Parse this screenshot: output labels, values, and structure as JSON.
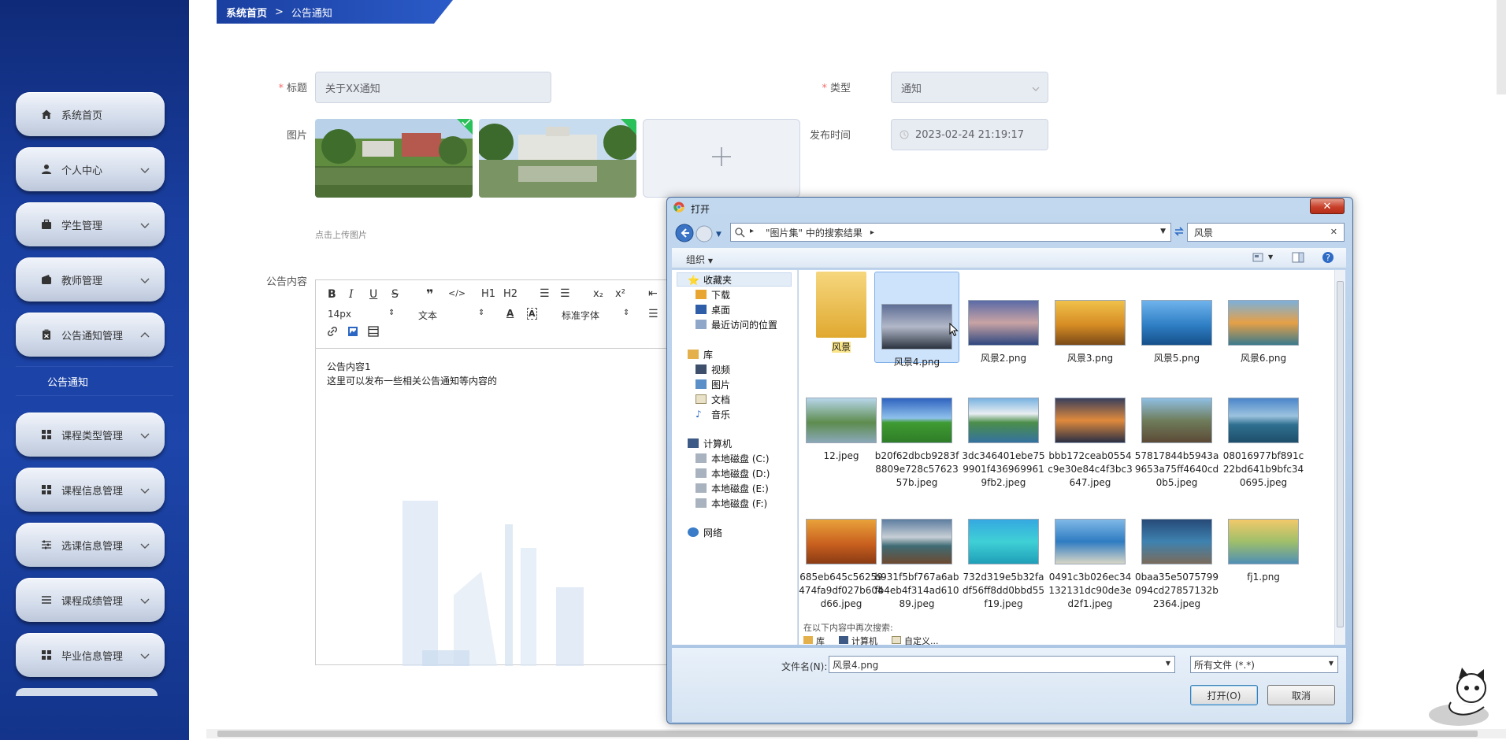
{
  "sidebar": {
    "items": [
      {
        "label": "系统首页",
        "icon": "home-icon"
      },
      {
        "label": "个人中心",
        "icon": "user-icon"
      },
      {
        "label": "学生管理",
        "icon": "briefcase-icon"
      },
      {
        "label": "教师管理",
        "icon": "wallet-icon"
      },
      {
        "label": "公告通知管理",
        "icon": "clipboard-icon"
      },
      {
        "label": "课程类型管理",
        "icon": "grid-icon"
      },
      {
        "label": "课程信息管理",
        "icon": "grid-icon"
      },
      {
        "label": "选课信息管理",
        "icon": "sliders-icon"
      },
      {
        "label": "课程成绩管理",
        "icon": "list-icon"
      },
      {
        "label": "毕业信息管理",
        "icon": "grid-icon"
      }
    ],
    "submenu": "公告通知"
  },
  "breadcrumb": {
    "home": "系统首页",
    "sep": ">",
    "current": "公告通知"
  },
  "form": {
    "title_label": "标题",
    "title_value": "关于XX通知",
    "type_label": "类型",
    "type_value": "通知",
    "image_label": "图片",
    "upload_hint": "点击上传图片",
    "publish_label": "发布时间",
    "publish_value": "2023-02-24 21:19:17",
    "content_label": "公告内容",
    "content_line1": "公告内容1",
    "content_line2": "这里可以发布一些相关公告通知等内容的"
  },
  "editor_toolbar": {
    "font_size": "14px",
    "paragraph": "文本",
    "font_family": "标准字体",
    "h1": "H1",
    "h2": "H2"
  },
  "dialog": {
    "title": "打开",
    "address": "\"图片集\" 中的搜索结果",
    "search_value": "风景",
    "organize": "组织",
    "nav": {
      "favorites": "收藏夹",
      "downloads": "下载",
      "desktop": "桌面",
      "recent": "最近访问的位置",
      "libraries": "库",
      "videos": "视频",
      "pictures": "图片",
      "documents": "文档",
      "music": "音乐",
      "computer": "计算机",
      "disk_c": "本地磁盘 (C:)",
      "disk_d": "本地磁盘 (D:)",
      "disk_e": "本地磁盘 (E:)",
      "disk_f": "本地磁盘 (F:)",
      "network": "网络"
    },
    "files_row1": [
      "风景",
      "风景4.png",
      "风景2.png",
      "风景3.png",
      "风景5.png",
      "风景6.png"
    ],
    "files_row2": [
      "12.jpeg",
      "b20f62dbcb9283f8809e728c5762357b.jpeg",
      "3dc346401ebe759901f4369699619fb2.jpeg",
      "bbb172ceab0554c9e30e84c4f3bc3647.jpeg",
      "57817844b5943a9653a75ff4640cd0b5.jpeg",
      "08016977bf891c22bd641b9bfc340695.jpeg"
    ],
    "files_row3": [
      "685eb645c56259474fa9df027b604d66.jpeg",
      "b931f5bf767a6abfb4eb4f314ad61089.jpeg",
      "732d319e5b32fadf56ff8dd0bbd55f19.jpeg",
      "0491c3b026ec34132131dc90de3ed2f1.jpeg",
      "0baa35e5075799094cd27857132b2364.jpeg",
      "fj1.png"
    ],
    "search_again": "在以下内容中再次搜索:",
    "search_again_items": [
      "库",
      "计算机",
      "自定义..."
    ],
    "filename_label": "文件名(N):",
    "filename_value": "风景4.png",
    "filter_value": "所有文件 (*.*)",
    "open_btn": "打开(O)",
    "cancel_btn": "取消"
  }
}
